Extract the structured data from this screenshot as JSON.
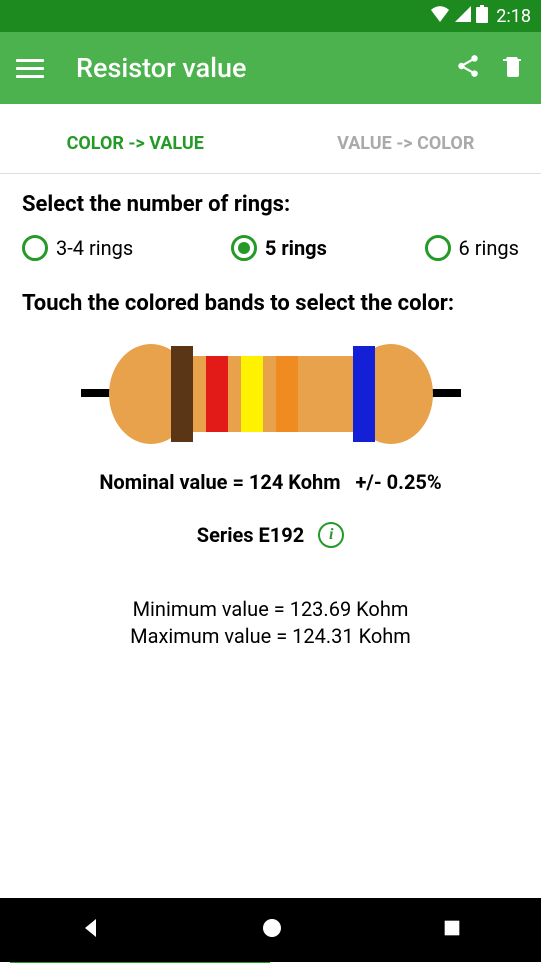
{
  "status": {
    "time": "2:18"
  },
  "appbar": {
    "title": "Resistor value"
  },
  "tabs": {
    "items": [
      {
        "label": "COLOR -> VALUE",
        "active": true
      },
      {
        "label": "VALUE -> COLOR",
        "active": false
      }
    ]
  },
  "rings": {
    "prompt": "Select the number of rings:",
    "options": [
      {
        "label": "3-4 rings",
        "selected": false
      },
      {
        "label": "5 rings",
        "selected": true
      },
      {
        "label": "6 rings",
        "selected": false
      }
    ]
  },
  "bands": {
    "prompt": "Touch the colored bands to select the color:",
    "colors": [
      "#5a3516",
      "#e21b18",
      "#fff200",
      "#ef8b21",
      "#1420d6"
    ]
  },
  "result": {
    "nominal_label": "Nominal value = ",
    "nominal_value": "124 Kohm",
    "tolerance": "+/- 0.25%",
    "series_label": "Series E192",
    "min_label": "Minimum value = ",
    "min_value": "123.69 Kohm",
    "max_label": "Maximum value = ",
    "max_value": "124.31 Kohm"
  },
  "resistor_body_color": "#e7a24b"
}
